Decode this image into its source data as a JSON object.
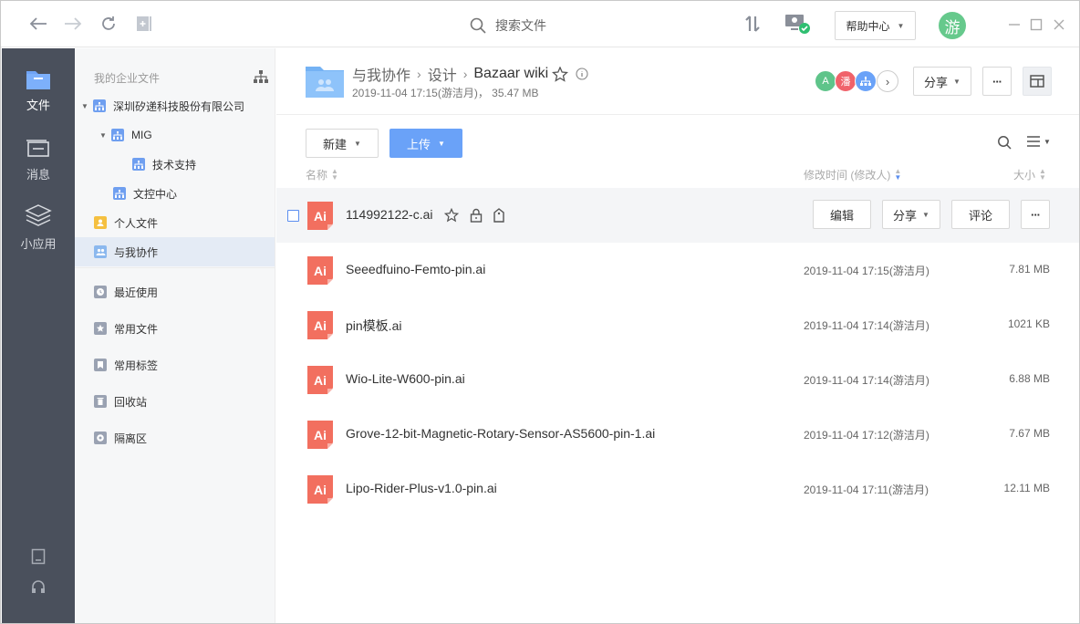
{
  "topbar": {
    "search_placeholder": "搜索文件",
    "help_label": "帮助中心",
    "user_initial": "游"
  },
  "rail": {
    "items": [
      {
        "label": "文件",
        "icon": "folder-icon"
      },
      {
        "label": "消息",
        "icon": "message-icon"
      },
      {
        "label": "小应用",
        "icon": "apps-icon"
      }
    ]
  },
  "tree": {
    "header": "我的企业文件",
    "company": "深圳矽递科技股份有限公司",
    "mig": "MIG",
    "tech_support": "技术支持",
    "doc_center": "文控中心",
    "personal": "个人文件",
    "shared": "与我协作",
    "recent": "最近使用",
    "frequent": "常用文件",
    "tags": "常用标签",
    "recycle": "回收站",
    "isolation": "隔离区"
  },
  "main": {
    "crumb_root": "与我协作",
    "crumb_mid": "设计",
    "crumb_current": "Bazaar wiki",
    "meta": "2019-11-04 17:15(游洁月)， 35.47 MB",
    "collaborators": [
      {
        "initial": "A",
        "color": "#5fc48a"
      },
      {
        "initial": "潘",
        "color": "#f0626a"
      }
    ],
    "share_label": "分享",
    "more_label": "···",
    "new_label": "新建",
    "upload_label": "上传",
    "col_name": "名称",
    "col_modified": "修改时间 (修改人)",
    "col_size": "大小",
    "row_edit": "编辑",
    "row_share": "分享",
    "row_comment": "评论",
    "files": [
      {
        "name": "114992122-c.ai",
        "date": "",
        "size": ""
      },
      {
        "name": "Seeedfuino-Femto-pin.ai",
        "date": "2019-11-04 17:15(游洁月)",
        "size": "7.81 MB"
      },
      {
        "name": "pin模板.ai",
        "date": "2019-11-04 17:14(游洁月)",
        "size": "1021 KB"
      },
      {
        "name": "Wio-Lite-W600-pin.ai",
        "date": "2019-11-04 17:14(游洁月)",
        "size": "6.88 MB"
      },
      {
        "name": "Grove-12-bit-Magnetic-Rotary-Sensor-AS5600-pin-1.ai",
        "date": "2019-11-04 17:12(游洁月)",
        "size": "7.67 MB"
      },
      {
        "name": "Lipo-Rider-Plus-v1.0-pin.ai",
        "date": "2019-11-04 17:11(游洁月)",
        "size": "12.11 MB"
      }
    ],
    "file_badge": "Ai"
  }
}
